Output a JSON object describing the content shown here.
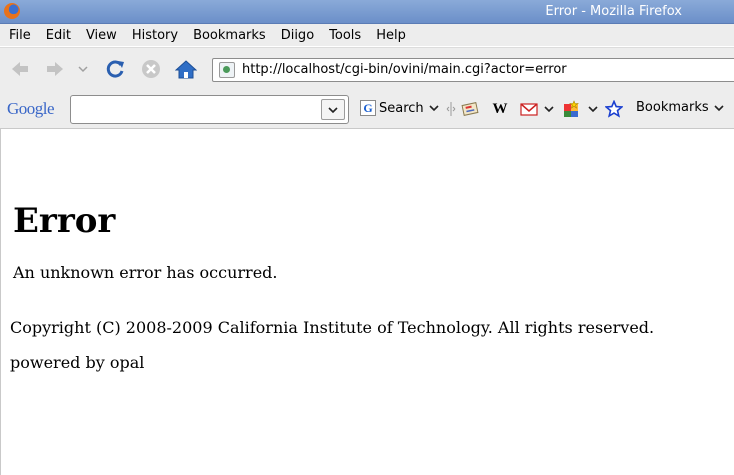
{
  "window": {
    "title": "Error - Mozilla Firefox"
  },
  "menu": {
    "items": [
      "File",
      "Edit",
      "View",
      "History",
      "Bookmarks",
      "Diigo",
      "Tools",
      "Help"
    ]
  },
  "navigation": {
    "url": "http://localhost/cgi-bin/ovini/main.cgi?actor=error"
  },
  "google_toolbar": {
    "logo": "Google",
    "search_value": "",
    "search_label": "Search",
    "bookmarks_label": "Bookmarks",
    "wikipedia_glyph": "W"
  },
  "page": {
    "heading": "Error",
    "message": "An unknown error has occurred.",
    "copyright": "Copyright (C) 2008-2009 California Institute of Technology. All rights reserved.",
    "powered_by": "powered by opal"
  },
  "colors": {
    "titlebar": "#7b9dd1",
    "toolbar_bg": "#ededed",
    "content_bg": "#ffffff"
  }
}
